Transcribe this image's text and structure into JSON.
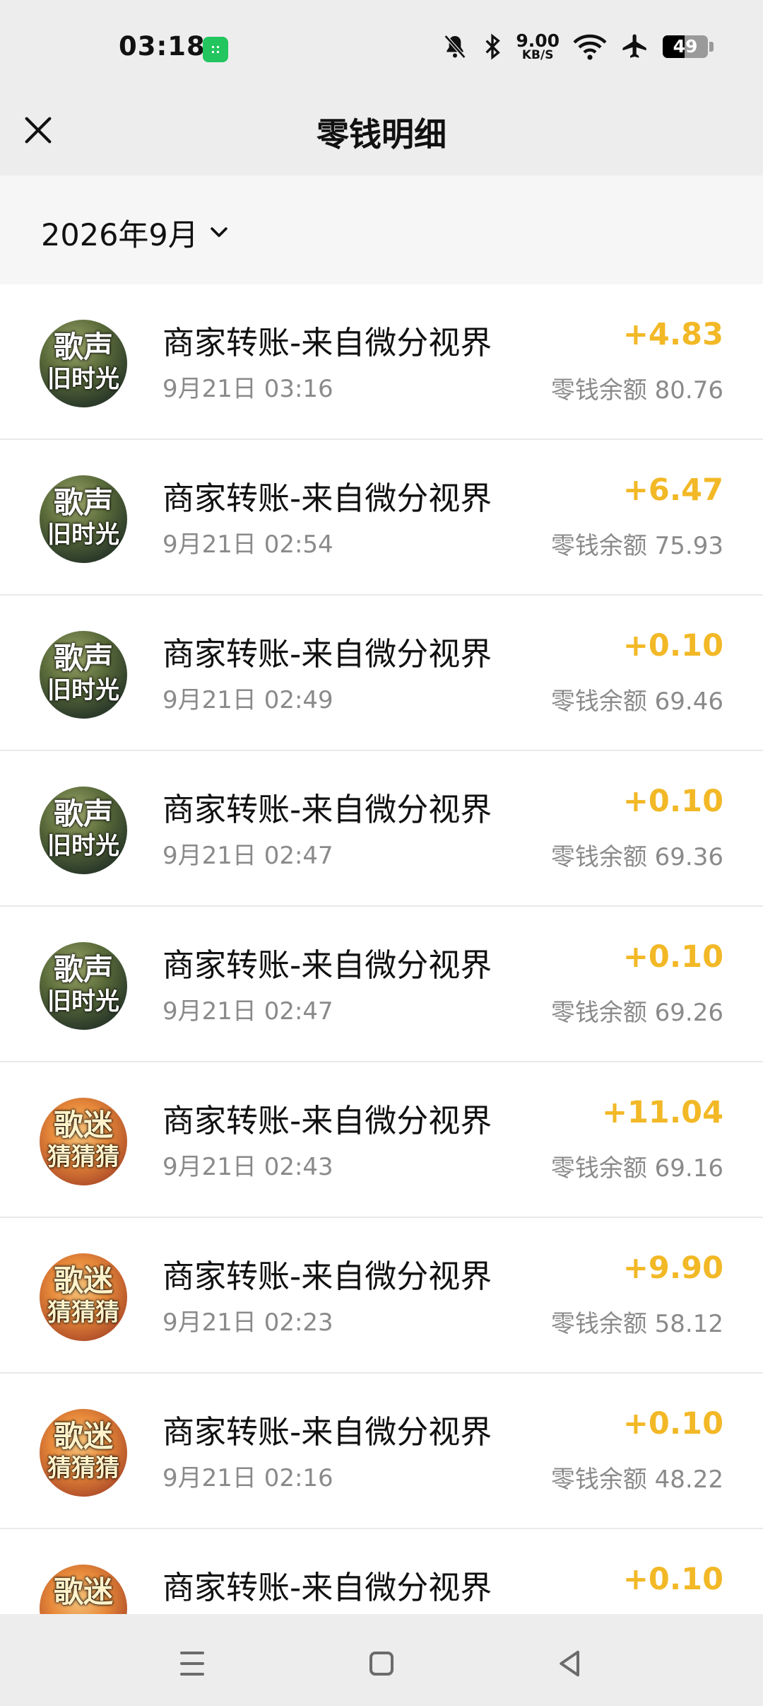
{
  "status": {
    "time": "03:18",
    "net_speed_value": "9.00",
    "net_speed_unit": "KB/S",
    "battery": "49",
    "battery_level": 0.49,
    "icons": [
      "mute-bell-icon",
      "bluetooth-icon",
      "wifi-icon",
      "airplane-icon",
      "battery-icon"
    ]
  },
  "header": {
    "title": "零钱明细",
    "close_icon": "close-icon"
  },
  "filter": {
    "month": "2026年9月",
    "chevron_icon": "chevron-down-icon"
  },
  "transactions": [
    {
      "avatar_line1": "歌声",
      "avatar_line2": "旧时光",
      "avatar_style": "green",
      "name": "商家转账-来自微分视界",
      "date": "9月21日 03:16",
      "amount": "+4.83",
      "balance": "零钱余额 80.76"
    },
    {
      "avatar_line1": "歌声",
      "avatar_line2": "旧时光",
      "avatar_style": "green",
      "name": "商家转账-来自微分视界",
      "date": "9月21日 02:54",
      "amount": "+6.47",
      "balance": "零钱余额 75.93"
    },
    {
      "avatar_line1": "歌声",
      "avatar_line2": "旧时光",
      "avatar_style": "green",
      "name": "商家转账-来自微分视界",
      "date": "9月21日 02:49",
      "amount": "+0.10",
      "balance": "零钱余额 69.46"
    },
    {
      "avatar_line1": "歌声",
      "avatar_line2": "旧时光",
      "avatar_style": "green",
      "name": "商家转账-来自微分视界",
      "date": "9月21日 02:47",
      "amount": "+0.10",
      "balance": "零钱余额 69.36"
    },
    {
      "avatar_line1": "歌声",
      "avatar_line2": "旧时光",
      "avatar_style": "green",
      "name": "商家转账-来自微分视界",
      "date": "9月21日 02:47",
      "amount": "+0.10",
      "balance": "零钱余额 69.26"
    },
    {
      "avatar_line1": "歌迷",
      "avatar_line2": "猜猜猜",
      "avatar_style": "orange",
      "name": "商家转账-来自微分视界",
      "date": "9月21日 02:43",
      "amount": "+11.04",
      "balance": "零钱余额 69.16"
    },
    {
      "avatar_line1": "歌迷",
      "avatar_line2": "猜猜猜",
      "avatar_style": "orange",
      "name": "商家转账-来自微分视界",
      "date": "9月21日 02:23",
      "amount": "+9.90",
      "balance": "零钱余额 58.12"
    },
    {
      "avatar_line1": "歌迷",
      "avatar_line2": "猜猜猜",
      "avatar_style": "orange",
      "name": "商家转账-来自微分视界",
      "date": "9月21日 02:16",
      "amount": "+0.10",
      "balance": "零钱余额 48.22"
    },
    {
      "avatar_line1": "歌迷",
      "avatar_line2": "",
      "avatar_style": "orange",
      "name": "商家转账-来自微分视界",
      "date": "",
      "amount": "+0.10",
      "balance": ""
    }
  ],
  "navigation": {
    "icons": [
      "menu-icon",
      "home-icon",
      "back-icon"
    ]
  },
  "colors": {
    "amount": "#f2b826",
    "header_bg": "#ededed",
    "muted_text": "#8a8a8a"
  }
}
